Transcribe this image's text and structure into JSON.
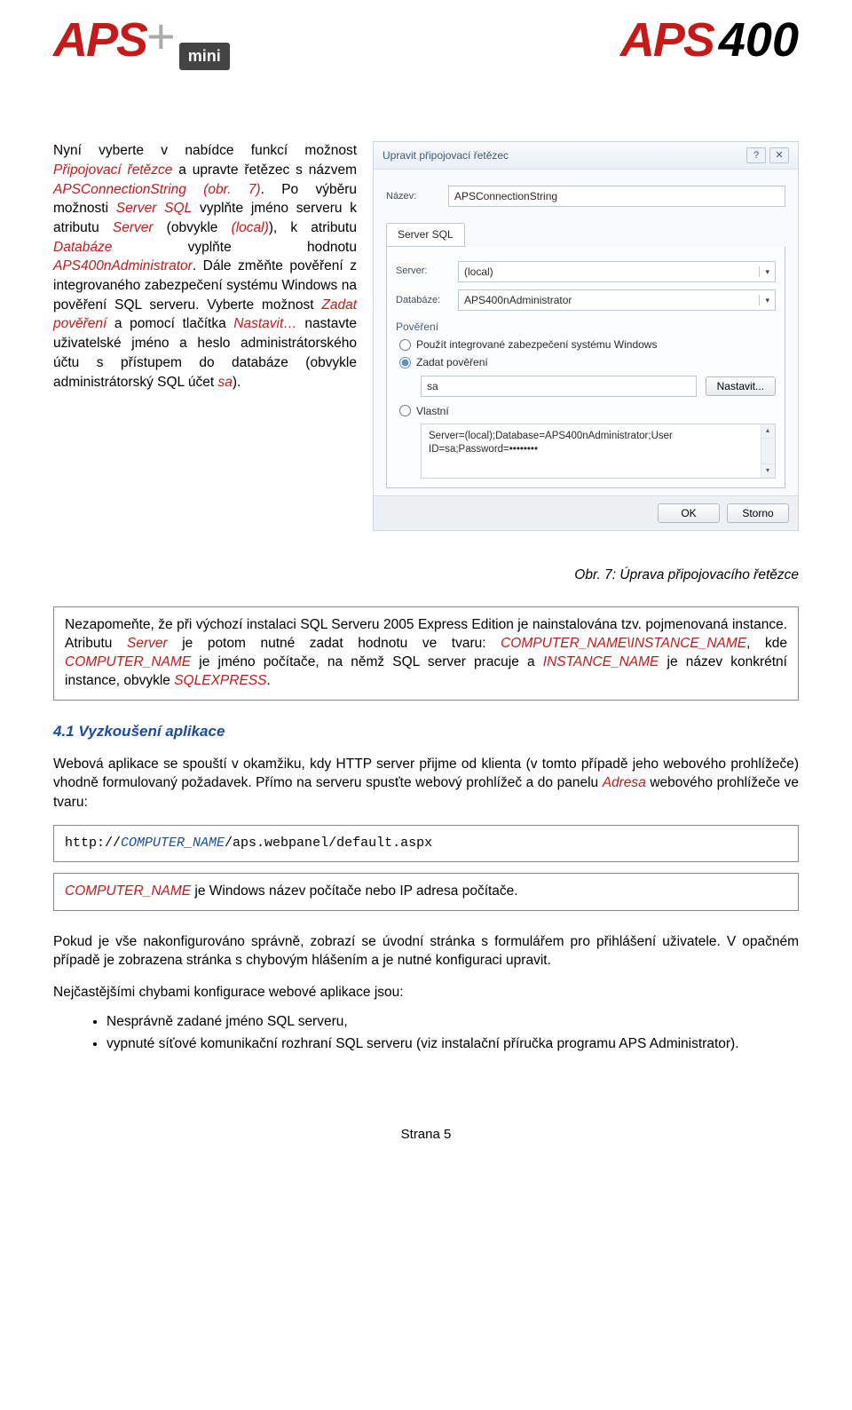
{
  "logos": {
    "aps": "APS",
    "mini": "mini",
    "plus": "+",
    "n400": "400"
  },
  "intro": {
    "a": "Nyní vyberte v nabídce funkcí možnost ",
    "i1": "Připojovací řetězce",
    "b": " a upravte řetězec s názvem ",
    "i2": "APSConnectionString (obr. 7)",
    "c": ". Po výběru možnosti ",
    "i3": "Server SQL",
    "d": " vyplňte jméno serveru k atributu ",
    "i4": "Server",
    "e": " (obvykle ",
    "i5": "(local)",
    "f": "), k atributu ",
    "i6": "Databáze",
    "g": " vyplňte hodnotu ",
    "i7": "APS400nAdministrator",
    "h": ". Dále změňte pověření z integrovaného zabezpečení systému Windows na pověření SQL serveru. Vyberte možnost ",
    "i8": "Zadat pověření",
    "j": " a pomocí tlačítka ",
    "i9": "Nastavit…",
    "k": " nastavte uživatelské jméno a heslo administrátorského účtu s přístupem do databáze (obvykle administrátorský SQL účet ",
    "i10": "sa",
    "l": ")."
  },
  "dialog": {
    "title": "Upravit připojovací řetězec",
    "help": "?",
    "close": "✕",
    "nazev_label": "Název:",
    "nazev_value": "APSConnectionString",
    "tab": "Server SQL",
    "server_label": "Server:",
    "server_value": "(local)",
    "db_label": "Databáze:",
    "db_value": "APS400nAdministrator",
    "pov_title": "Pověření",
    "radio_win": "Použít integrované zabezpečení systému Windows",
    "radio_set": "Zadat pověření",
    "sa_value": "sa",
    "set_btn": "Nastavit...",
    "radio_own": "Vlastní",
    "conn_l1": "Server=(local);Database=APS400nAdministrator;User",
    "conn_l2": "ID=sa;Password=••••••••",
    "ok": "OK",
    "cancel": "Storno"
  },
  "caption": "Obr. 7: Úprava připojovacího řetězce",
  "note": {
    "a": "Nezapomeňte, že při výchozí instalaci SQL Serveru 2005 Express Edition je nainstalována tzv. pojmenovaná instance. Atributu ",
    "i1": "Server",
    "b": " je potom nutné zadat hodnotu ve tvaru: ",
    "i2": "COMPUTER_NAME\\INSTANCE_NAME",
    "c": ", kde ",
    "i3": "COMPUTER_NAME",
    "d": " je jméno počítače, na němž SQL server pracuje a ",
    "i4": "INSTANCE_NAME",
    "e": " je název konkrétní instance, obvykle ",
    "i5": "SQLEXPRESS",
    "f": "."
  },
  "section41": "4.1 Vyzkoušení aplikace",
  "para41": {
    "a": "Webová aplikace se spouští v okamžiku, kdy HTTP server přijme od klienta (v tomto případě jeho webového prohlížeče) vhodně formulovaný požadavek. Přímo na serveru spusťte webový prohlížeč a do panelu ",
    "i1": "Adresa",
    "b": " webového prohlížeče ve tvaru:"
  },
  "url": {
    "a": "http://",
    "b": "COMPUTER_NAME",
    "c": "/aps.webpanel/default.aspx"
  },
  "url_note": {
    "i1": "COMPUTER_NAME",
    "a": " je Windows název počítače nebo IP adresa počítače."
  },
  "para42": "Pokud je vše nakonfigurováno správně, zobrazí se úvodní stránka s formulářem pro přihlášení uživatele. V opačném případě je zobrazena stránka s chybovým hlášením a je nutné konfiguraci upravit.",
  "para43": "Nejčastějšími chybami konfigurace webové aplikace jsou:",
  "bullets": {
    "b1": "Nesprávně zadané jméno SQL serveru,",
    "b2": "vypnuté síťové komunikační rozhraní SQL serveru (viz instalační příručka programu APS Administrator)."
  },
  "footer": "Strana 5"
}
